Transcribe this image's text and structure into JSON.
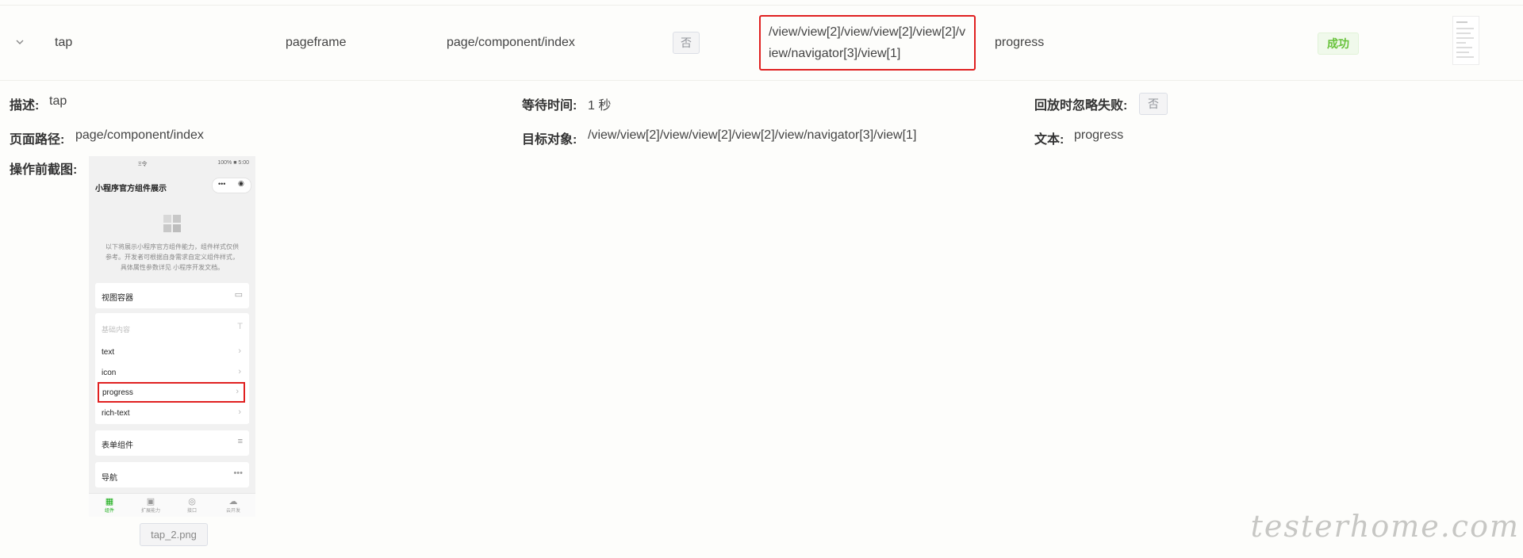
{
  "row": {
    "name": "tap",
    "frame": "pageframe",
    "page_path": "page/component/index",
    "ignore_fail": "否",
    "target": "/view/view[2]/view/view[2]/view[2]/view/navigator[3]/view[1]",
    "text": "progress",
    "status": "成功"
  },
  "detail": {
    "desc_label": "描述:",
    "desc_value": "tap",
    "wait_label": "等待时间:",
    "wait_value": "1 秒",
    "ignore_label": "回放时忽略失败:",
    "ignore_value": "否",
    "path_label": "页面路径:",
    "path_value": "page/component/index",
    "target_label": "目标对象:",
    "target_value": "/view/view[2]/view/view[2]/view[2]/view/navigator[3]/view[1]",
    "text_label": "文本:",
    "text_value": "progress",
    "screenshot_label": "操作前截图:",
    "screenshot_file": "tap_2.png"
  },
  "phone": {
    "status_left": "Ξ令",
    "status_right": "100% ■ 5:00",
    "title": "小程序官方组件展示",
    "desc": "以下将展示小程序官方组件能力，组件样式仅供参考。开发者可根据自身需求自定义组件样式，具体属性参数详见 小程序开发文档。",
    "card_view": "视图容器",
    "card_basic": "基础内容",
    "items": [
      "text",
      "icon",
      "progress",
      "rich-text"
    ],
    "card_form": "表单组件",
    "card_nav": "导航",
    "tabs": [
      "组件",
      "扩展能力",
      "接口",
      "云开发"
    ]
  },
  "watermark": "testerhome.com"
}
